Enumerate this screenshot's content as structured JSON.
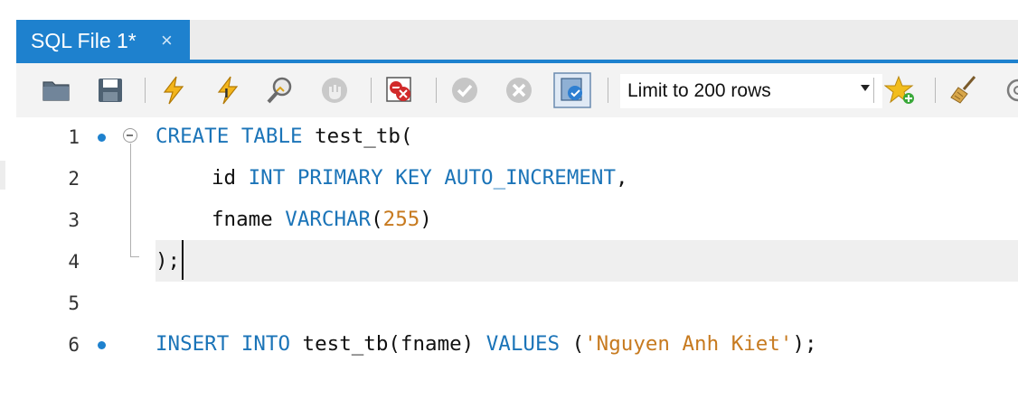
{
  "tab": {
    "label": "SQL File 1*",
    "close_glyph": "×"
  },
  "toolbar": {
    "icons": [
      "open-folder-icon",
      "save-icon",
      "execute-icon",
      "execute-current-icon",
      "explain-icon",
      "stop-icon",
      "toggle-error-stop-icon",
      "commit-icon",
      "rollback-icon",
      "autocommit-icon",
      "add-snippet-icon",
      "beautify-icon",
      "find-icon"
    ],
    "limit_select": {
      "value": "Limit to 200 rows"
    }
  },
  "editor": {
    "lines": [
      {
        "number": "1",
        "breakpoint": true
      },
      {
        "number": "2",
        "breakpoint": false
      },
      {
        "number": "3",
        "breakpoint": false
      },
      {
        "number": "4",
        "breakpoint": false
      },
      {
        "number": "5",
        "breakpoint": false
      },
      {
        "number": "6",
        "breakpoint": true
      }
    ],
    "code": {
      "l1_kw": "CREATE TABLE",
      "l1_rest": " test_tb(",
      "l2_ident": "id",
      "l2_kw": "INT PRIMARY KEY AUTO_INCREMENT",
      "l2_end": ",",
      "l3_ident": "fname",
      "l3_kw": "VARCHAR",
      "l3_open": "(",
      "l3_num": "255",
      "l3_close": ")",
      "l4": ");",
      "l6_kw1": "INSERT INTO",
      "l6_mid": " test_tb(fname) ",
      "l6_kw2": "VALUES",
      "l6_open": " (",
      "l6_str": "'Nguyen Anh Kiet'",
      "l6_end": ");"
    }
  },
  "colors": {
    "accent": "#1e81ce",
    "keyword": "#1b74b8",
    "string": "#c77a1f"
  }
}
